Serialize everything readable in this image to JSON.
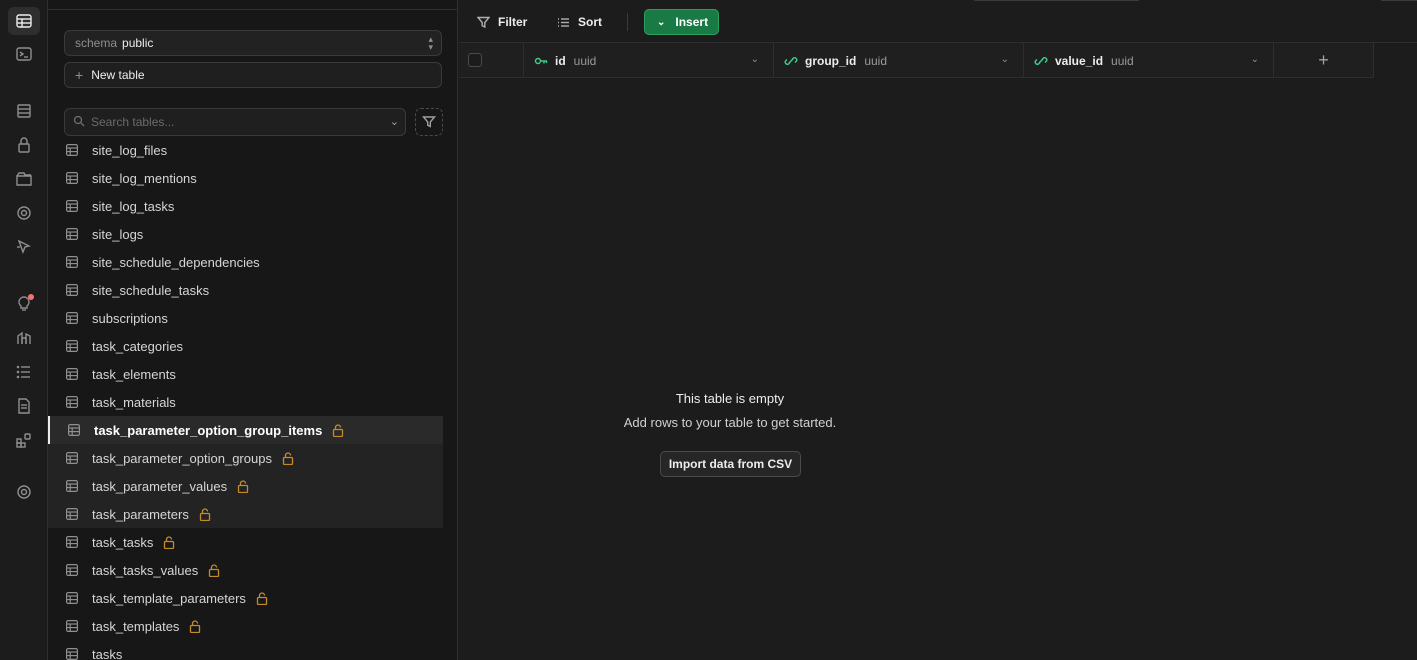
{
  "rail": {
    "items": [
      {
        "name": "table-editor",
        "icon": "table-icon",
        "active": true
      },
      {
        "name": "sql-editor",
        "icon": "terminal-icon"
      },
      {
        "name": "database",
        "icon": "database-icon"
      },
      {
        "name": "authentication",
        "icon": "lock-icon"
      },
      {
        "name": "storage",
        "icon": "archive-icon"
      },
      {
        "name": "realtime",
        "icon": "realtime-icon"
      },
      {
        "name": "edge-functions",
        "icon": "pointer-icon"
      },
      {
        "name": "advisors",
        "icon": "lightbulb-icon",
        "notification": true
      },
      {
        "name": "reports",
        "icon": "chart-icon"
      },
      {
        "name": "logs",
        "icon": "list-icon"
      },
      {
        "name": "api-docs",
        "icon": "document-icon"
      },
      {
        "name": "integrations",
        "icon": "integrations-icon"
      },
      {
        "name": "settings",
        "icon": "gear-icon"
      }
    ]
  },
  "panel": {
    "schema_label": "schema",
    "schema_value": "public",
    "new_table_label": "New table",
    "search_placeholder": "Search tables...",
    "tables": [
      {
        "name": "site_log_files",
        "locked": false
      },
      {
        "name": "site_log_mentions",
        "locked": false
      },
      {
        "name": "site_log_tasks",
        "locked": false
      },
      {
        "name": "site_logs",
        "locked": false
      },
      {
        "name": "site_schedule_dependencies",
        "locked": false
      },
      {
        "name": "site_schedule_tasks",
        "locked": false
      },
      {
        "name": "subscriptions",
        "locked": false
      },
      {
        "name": "task_categories",
        "locked": false
      },
      {
        "name": "task_elements",
        "locked": false
      },
      {
        "name": "task_materials",
        "locked": false
      },
      {
        "name": "task_parameter_option_group_items",
        "locked": true,
        "state": "selected"
      },
      {
        "name": "task_parameter_option_groups",
        "locked": true,
        "state": "highlighted"
      },
      {
        "name": "task_parameter_values",
        "locked": true,
        "state": "highlighted"
      },
      {
        "name": "task_parameters",
        "locked": true,
        "state": "highlighted"
      },
      {
        "name": "task_tasks",
        "locked": true
      },
      {
        "name": "task_tasks_values",
        "locked": true
      },
      {
        "name": "task_template_parameters",
        "locked": true
      },
      {
        "name": "task_templates",
        "locked": true
      },
      {
        "name": "tasks",
        "locked": false
      }
    ]
  },
  "toolbar": {
    "filter_label": "Filter",
    "sort_label": "Sort",
    "insert_label": "Insert"
  },
  "columns": [
    {
      "name": "id",
      "type": "uuid",
      "icon": "key-icon"
    },
    {
      "name": "group_id",
      "type": "uuid",
      "icon": "link-icon"
    },
    {
      "name": "value_id",
      "type": "uuid",
      "icon": "link-icon"
    }
  ],
  "add_column_label": "+",
  "empty_state": {
    "title": "This table is empty",
    "subtitle": "Add rows to your table to get started.",
    "import_label": "Import data from CSV"
  },
  "colors": {
    "accent": "#3ecf8e",
    "insert_bg": "#1a7a45",
    "lock": "#c58a2a",
    "notification": "#f87171"
  }
}
